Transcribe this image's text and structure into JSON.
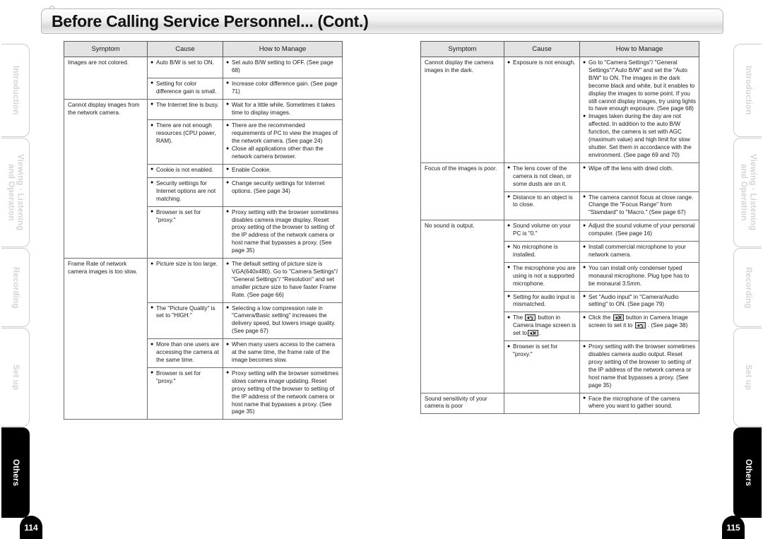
{
  "header": {
    "title": "Before Calling Service Personnel... (Cont.)",
    "decorations": [
      "bubble-large",
      "bubble-medium",
      "bubble-small"
    ]
  },
  "side_tabs": [
    {
      "id": "introduction",
      "label": "Introduction",
      "active": false
    },
    {
      "id": "viewing-listening-operation",
      "label": "Viewing · Listening\nand Operation",
      "active": false
    },
    {
      "id": "recording",
      "label": "Recording",
      "active": false
    },
    {
      "id": "set-up",
      "label": "Set up",
      "active": false
    },
    {
      "id": "others",
      "label": "Others",
      "active": true
    }
  ],
  "pages": {
    "left_number": "114",
    "right_number": "115"
  },
  "table_columns": [
    "Symptom",
    "Cause",
    "How to Manage"
  ],
  "left_page": {
    "groups": [
      {
        "symptom": "Images are not colored.",
        "rows": [
          {
            "cause": [
              "Auto B/W is set to ON."
            ],
            "manage": [
              "Set auto B/W setting to OFF. (See page 68)"
            ]
          },
          {
            "cause": [
              "Setting for color difference gain is small."
            ],
            "manage": [
              "Increase color difference gain. (See page 71)"
            ]
          }
        ]
      },
      {
        "symptom": "Cannot display images from the network camera.",
        "rows": [
          {
            "cause": [
              "The Internet line is busy."
            ],
            "manage": [
              "Wait for a little while. Sometimes it takes time to display images."
            ]
          },
          {
            "cause": [
              "There are not enough resources (CPU power, RAM)."
            ],
            "manage": [
              "There are the recommended requirements of PC to view the images of the network camera. (See page  24)",
              "Close all applications other than the network camera browser."
            ]
          },
          {
            "cause": [
              "Cookie is not enabled."
            ],
            "manage": [
              "Enable Cookie."
            ]
          },
          {
            "cause": [
              "Security settings for Internet options are not matching."
            ],
            "manage": [
              "Change security settings for Internet options.  (See page 34)"
            ]
          },
          {
            "cause": [
              "Browser is set for \"proxy.\""
            ],
            "manage": [
              "Proxy setting with the browser sometimes disables camera image display.  Reset proxy setting of the browser to setting of the IP address of the network camera or host name that bypasses a proxy. (See page 35)"
            ]
          }
        ]
      },
      {
        "symptom": "Frame Rate of network camera images is too slow.",
        "rows": [
          {
            "cause": [
              "Picture size is too large."
            ],
            "manage": [
              "The default setting of picture size is VGA(640x480). Go to \"Camera Settings\"/ \"General Settings\"/ \"Resolution\" and set smaller picture size to have faster Frame Rate. (See page 66)"
            ]
          },
          {
            "cause": [
              "The \"Picture Quality\" is set to \"HIGH.\""
            ],
            "manage": [
              "Selecting a low compression rate in \"Camera/Basic setting\" increases the delivery speed, but lowers image quality.  (See page 67)"
            ]
          },
          {
            "cause": [
              "More than one users are accessing the camera at the same time."
            ],
            "manage": [
              "When many users access to the camera at the same time, the frame rate of the image becomes slow."
            ]
          },
          {
            "cause": [
              "Browser is set for \"proxy.\""
            ],
            "manage": [
              "Proxy setting with the browser sometimes slows camera image updating.  Reset proxy setting of the browser to setting of the IP address of the network camera or host name that bypasses a proxy. (See page 35)"
            ]
          }
        ]
      }
    ]
  },
  "right_page": {
    "groups": [
      {
        "symptom": "Cannot display the camera images in the dark.",
        "rows": [
          {
            "cause": [
              "Exposure is not enough."
            ],
            "manage": [
              "Go to \"Camera Settings\"/ \"General Settings\"/\"Auto B/W\" and set the \"Auto B/W\" to ON. The images in the dark become black and white, but it enables to display the images to some point. If you still cannot display images, try using lights to have enough exposure. (See page 68)",
              "Images taken during the day are not affected.  In addition to the auto B/W function, the camera is set with AGC (maximum value) and high limit for slow shutter.  Set them in accordance with the environment.  (See page 69 and 70)"
            ]
          }
        ]
      },
      {
        "symptom": "Focus of the images is poor.",
        "rows": [
          {
            "cause": [
              "The lens cover of the camera is not clean, or some dusts are on it."
            ],
            "manage": [
              "Wipe off the lens with dried cloth."
            ]
          },
          {
            "cause": [
              "Distance to an object is to close."
            ],
            "manage": [
              "The camera cannot focus at close range. Change the \"Focus Range\" from \"Stamdard\" to \"Macro.\" (See page 67)"
            ]
          }
        ]
      },
      {
        "symptom": "No sound is output.",
        "rows": [
          {
            "cause": [
              "Sound volume on your PC is \"0.\""
            ],
            "manage": [
              "Adjust the sound volume of your personal computer. (See page 16)"
            ]
          },
          {
            "cause": [
              "No microphone is installed."
            ],
            "manage": [
              "Install commercial microphone to your network camera."
            ]
          },
          {
            "cause": [
              "The microphone you are using is not a supported microphone."
            ],
            "manage": [
              "You can install only condenser typed monaural microphone. Plug type has to be monaural 3.5mm."
            ]
          },
          {
            "cause": [
              "Setting for audio input is mismatched."
            ],
            "manage": [
              "Set \"Audio input\" in \"Camera/Audio setting\" to ON.  (See page 79)"
            ]
          },
          {
            "cause_html": "The <span class=\"spk\" data-name=\"speaker-on-icon\" data-interactable=\"false\"></span> button in Camera Image screen is set to<span class=\"spk muted\" data-name=\"speaker-muted-icon\" data-interactable=\"false\"></span>.",
            "manage_html": "Click the <span class=\"spk muted\" data-name=\"speaker-muted-icon\" data-interactable=\"false\"></span> button in Camera Image screen to set it to <span class=\"spk\" data-name=\"speaker-on-icon\" data-interactable=\"false\"></span> . (See page 38)"
          },
          {
            "cause": [
              "Browser is set for \"proxy.\""
            ],
            "manage": [
              "Proxy setting with the browser sometimes disables camera audio output.  Reset proxy setting of the browser to setting of the IP address of the network camera or host name that bypasses a proxy. (See page 35)"
            ]
          }
        ]
      },
      {
        "symptom": "Sound sensitivity of your camera is poor",
        "rows": [
          {
            "cause": [],
            "manage": [
              "Face the microphone of the camera where you want to gather sound."
            ]
          }
        ]
      }
    ]
  },
  "colors": {
    "header_fill": "#e3e3e3",
    "border": "#1a1a1a",
    "active_tab_bg": "#000000",
    "inactive_tab_text": "#d5d5d5"
  }
}
